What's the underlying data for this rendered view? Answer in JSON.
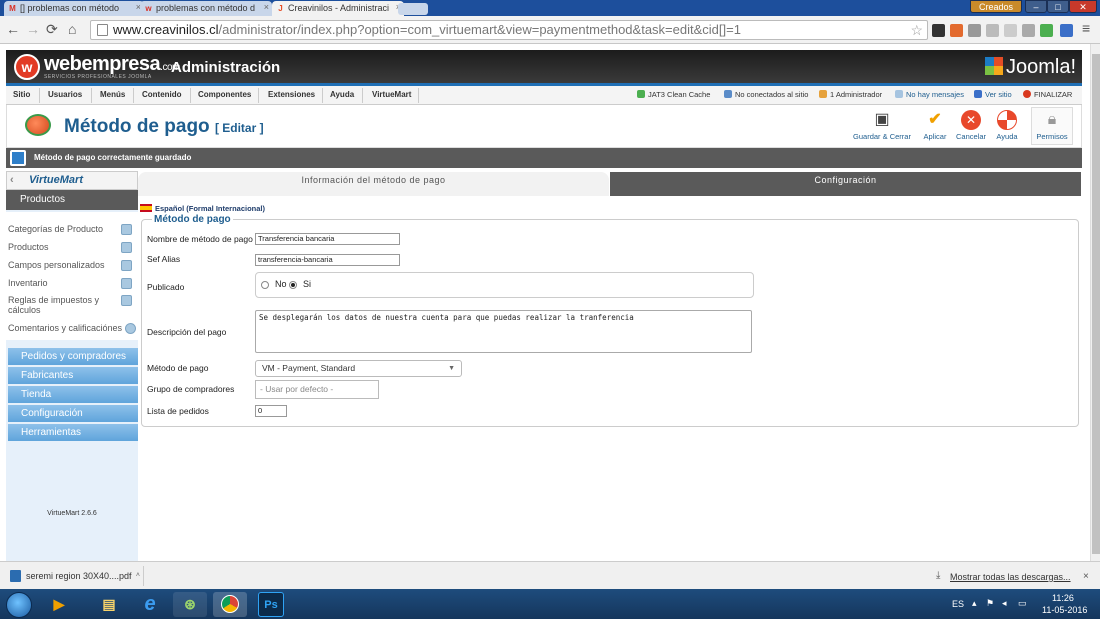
{
  "browser": {
    "tabs": [
      {
        "label": "[] problemas con método",
        "fav": "M"
      },
      {
        "label": "problemas con método d",
        "fav": "w"
      },
      {
        "label": "Creavinilos - Administraci",
        "fav": "J"
      }
    ],
    "window_buttons": {
      "user": "Creados",
      "min": "–",
      "max": "□",
      "close": "✕"
    },
    "url_host": "www.creavinilos.cl",
    "url_path": "/administrator/index.php?option=com_virtuemart&view=paymentmethod&task=edit&cid[]=1"
  },
  "header": {
    "brand": "webempresa",
    "brand_suffix": ".com",
    "brand_sub": "SERVICIOS PROFESIONALES JOOMLA",
    "admin_title": "Administración",
    "joomla": "Joomla!"
  },
  "menu": {
    "items": [
      "Sitio",
      "Usuarios",
      "Menús",
      "Contenido",
      "Componentes",
      "Extensiones",
      "Ayuda",
      "VirtueMart"
    ],
    "right": [
      "JAT3 Clean Cache",
      "No conectados al sitio",
      "1 Administrador",
      "No hay mensajes",
      "Ver sitio",
      "FINALIZAR"
    ]
  },
  "title": {
    "main": "Método de pago",
    "sub": "[ Editar ]"
  },
  "toolbar": {
    "save_close": "Guardar & Cerrar",
    "apply": "Aplicar",
    "cancel": "Cancelar",
    "help": "Ayuda",
    "permissions": "Permisos"
  },
  "message": "Método de pago correctamente guardado",
  "sidebar": {
    "logo": "VirtueMart",
    "products_header": "Productos",
    "products": [
      "Categorías de Producto",
      "Productos",
      "Campos personalizados",
      "Inventario",
      "Reglas de impuestos y cálculos",
      "Comentarios y calificaciónes"
    ],
    "sections": [
      "Pedidos y compradores",
      "Fabricantes",
      "Tienda",
      "Configuración",
      "Herramientas"
    ],
    "version": "VirtueMart 2.6.6"
  },
  "tabs": {
    "info": "Información del método de pago",
    "config": "Configuración"
  },
  "form": {
    "language": "Español (Formal Internacional)",
    "legend": "Método de pago",
    "name_label": "Nombre de método de pago",
    "name_value": "Transferencia bancaria",
    "alias_label": "Sef Alias",
    "alias_value": "transferencia-bancaria",
    "published_label": "Publicado",
    "published_no": "No",
    "published_yes": "Si",
    "description_label": "Descripción del pago",
    "description_value": "Se desplegarán los datos de nuestra cuenta para que puedas realizar la tranferencia",
    "method_label": "Método de pago",
    "method_value": "VM - Payment, Standard",
    "group_label": "Grupo de compradores",
    "group_placeholder": "- Usar por defecto -",
    "order_label": "Lista de pedidos",
    "order_value": "0"
  },
  "downloads": {
    "file": "seremi region 30X40....pdf",
    "show_all": "Mostrar todas las descargas...",
    "close": "×"
  },
  "taskbar": {
    "lang": "ES",
    "time": "11:26",
    "date": "11-05-2016"
  }
}
